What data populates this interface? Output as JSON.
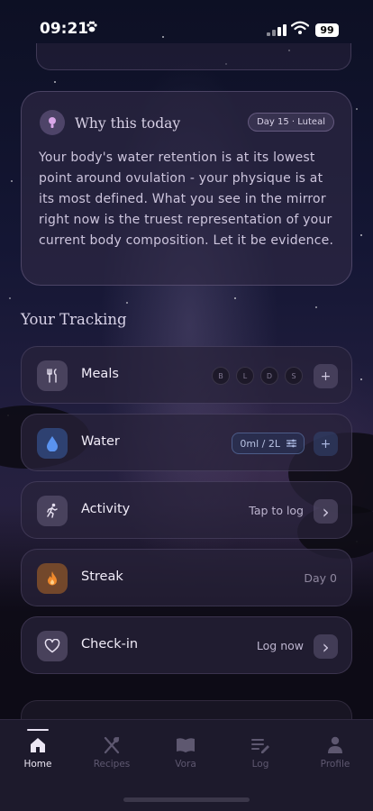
{
  "status_bar": {
    "time": "09:21",
    "battery": "99"
  },
  "why_card": {
    "title": "Why this today",
    "badge": "Day 15 · Luteal",
    "body": "Your body's water retention is at its lowest point around ovulation - your physique is at its most defined. What you see in the mirror right now is the truest representation of your current body composition. Let it be evidence."
  },
  "tracking": {
    "title": "Your Tracking",
    "meals": {
      "label": "Meals",
      "dots": [
        "B",
        "L",
        "D",
        "S"
      ],
      "action": "+"
    },
    "water": {
      "label": "Water",
      "amount": "0ml / 2L",
      "action": "+"
    },
    "activity": {
      "label": "Activity",
      "status": "Tap to log",
      "action": "›"
    },
    "streak": {
      "label": "Streak",
      "status": "Day 0"
    },
    "checkin": {
      "label": "Check-in",
      "status": "Log now",
      "action": "›"
    }
  },
  "tabbar": {
    "tabs": [
      {
        "label": "Home"
      },
      {
        "label": "Recipes"
      },
      {
        "label": "Vora"
      },
      {
        "label": "Log"
      },
      {
        "label": "Profile"
      }
    ]
  },
  "colors": {
    "accent_water": "#4f86e6",
    "accent_streak": "#f08a2c",
    "accent_bulb": "#d9a6e8"
  }
}
